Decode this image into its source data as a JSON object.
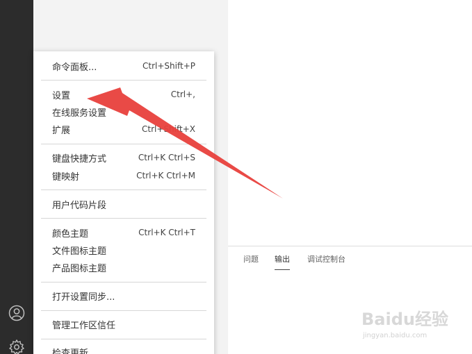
{
  "menu": {
    "items": [
      {
        "label": "命令面板...",
        "shortcut": "Ctrl+Shift+P"
      },
      {
        "label": "设置",
        "shortcut": "Ctrl+,"
      },
      {
        "label": "在线服务设置",
        "shortcut": ""
      },
      {
        "label": "扩展",
        "shortcut": "Ctrl+Shift+X"
      },
      {
        "label": "键盘快捷方式",
        "shortcut": "Ctrl+K Ctrl+S"
      },
      {
        "label": "键映射",
        "shortcut": "Ctrl+K Ctrl+M"
      },
      {
        "label": "用户代码片段",
        "shortcut": ""
      },
      {
        "label": "颜色主题",
        "shortcut": "Ctrl+K Ctrl+T"
      },
      {
        "label": "文件图标主题",
        "shortcut": ""
      },
      {
        "label": "产品图标主题",
        "shortcut": ""
      },
      {
        "label": "打开设置同步...",
        "shortcut": ""
      },
      {
        "label": "管理工作区信任",
        "shortcut": ""
      },
      {
        "label": "检查更新...",
        "shortcut": ""
      }
    ]
  },
  "panel": {
    "tabs": [
      {
        "label": "问题"
      },
      {
        "label": "输出"
      },
      {
        "label": "调试控制台"
      }
    ]
  },
  "activity_bar": {
    "icons": [
      "account-icon",
      "manage-gear-icon"
    ]
  },
  "watermark": {
    "text": "Baidu经验",
    "sub": "jingyan.baidu.com"
  },
  "colors": {
    "activity_bar": "#2c2c2c",
    "sidebar": "#f3f3f3",
    "arrow": "#e8403c"
  }
}
